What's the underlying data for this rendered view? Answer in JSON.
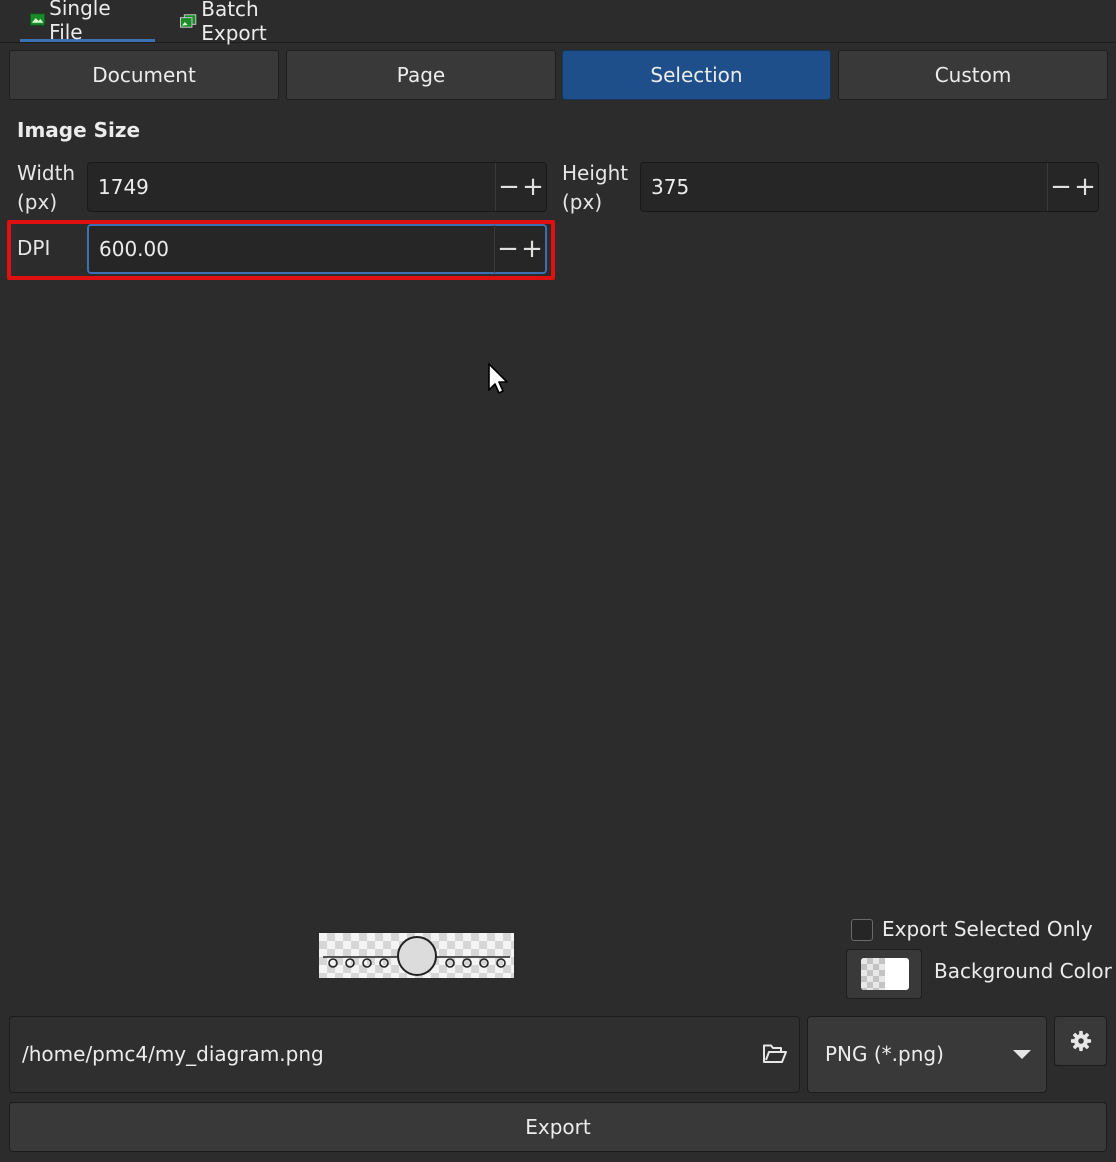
{
  "tabs": [
    {
      "label": "Single File",
      "icon": "image-icon",
      "active": true
    },
    {
      "label": "Batch Export",
      "icon": "stacked-images-icon",
      "active": false
    }
  ],
  "area_buttons": [
    {
      "label": "Document"
    },
    {
      "label": "Page"
    },
    {
      "label": "Selection",
      "active": true
    },
    {
      "label": "Custom"
    }
  ],
  "image_size": {
    "title": "Image Size",
    "width_label_1": "Width",
    "width_label_2": "(px)",
    "width_value": "1749",
    "height_label_1": "Height",
    "height_label_2": "(px)",
    "height_value": "375",
    "dpi_label": "DPI",
    "dpi_value": "600.00"
  },
  "options": {
    "export_selected_only_label": "Export Selected Only",
    "export_selected_only_checked": false,
    "background_color_label": "Background Color"
  },
  "file": {
    "path": "/home/pmc4/my_diagram.png",
    "format": "PNG (*.png)"
  },
  "export_label": "Export",
  "colors": {
    "accent": "#3d6fb3",
    "active_button": "#1f4f8a",
    "highlight": "#e01010",
    "background": "#2c2c2c"
  }
}
